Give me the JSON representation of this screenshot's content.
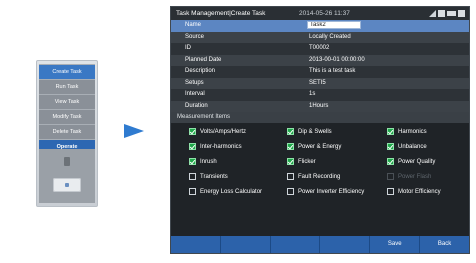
{
  "device": {
    "menu": [
      "Create Task",
      "Run Task",
      "View Task",
      "Modify Task",
      "Delete Task"
    ],
    "operate_label": "Operate"
  },
  "screen": {
    "title": "Task Management|Create Task",
    "datetime": "2014-05-26 11:37"
  },
  "task": {
    "name_label": "Name",
    "name_value": "Task2",
    "rows": [
      {
        "label": "Source",
        "value": "Locally Created"
      },
      {
        "label": "ID",
        "value": "T00002"
      },
      {
        "label": "Planned Date",
        "value": "2013-00-01 00:00:00"
      },
      {
        "label": "Description",
        "value": "This is a test task"
      },
      {
        "label": "Setups",
        "value": "SETI5"
      },
      {
        "label": "Interval",
        "value": "1s"
      },
      {
        "label": "Duration",
        "value": "1Hours"
      }
    ]
  },
  "measurement": {
    "section_title": "Measurement Items",
    "items": [
      {
        "label": "Volts/Amps/Hertz",
        "checked": true
      },
      {
        "label": "Dip & Swells",
        "checked": true
      },
      {
        "label": "Harmonics",
        "checked": true
      },
      {
        "label": "Inter-harmonics",
        "checked": true
      },
      {
        "label": "Power & Energy",
        "checked": true
      },
      {
        "label": "Unbalance",
        "checked": true
      },
      {
        "label": "Inrush",
        "checked": true
      },
      {
        "label": "Flicker",
        "checked": true
      },
      {
        "label": "Power Quality",
        "checked": true
      },
      {
        "label": "Transients",
        "checked": false
      },
      {
        "label": "Fault Recording",
        "checked": false
      },
      {
        "label": "Power Flash",
        "checked": false
      },
      {
        "label": "Energy Loss Calculator",
        "checked": false
      },
      {
        "label": "Power Inverter Efficiency",
        "checked": false
      },
      {
        "label": "Motor Efficiency",
        "checked": false
      }
    ]
  },
  "bottombar": {
    "buttons": [
      "",
      "",
      "",
      "",
      "Save",
      "Back"
    ]
  },
  "colors": {
    "accent": "#2c62aa",
    "checked": "#1fa84a",
    "arrow": "#2f7bd0"
  }
}
